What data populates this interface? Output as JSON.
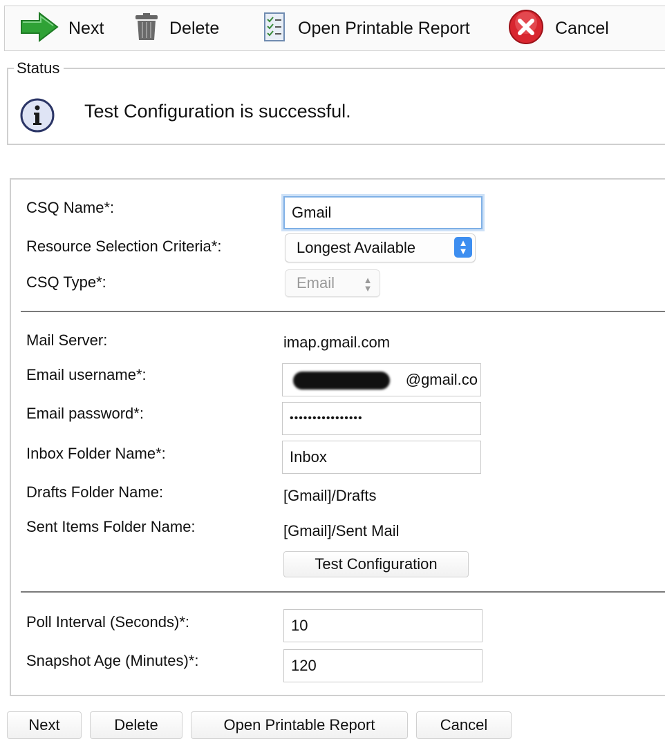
{
  "toolbar": {
    "next_label": "Next",
    "delete_label": "Delete",
    "report_label": "Open Printable Report",
    "cancel_label": "Cancel"
  },
  "status": {
    "legend": "Status",
    "message": "Test Configuration is successful."
  },
  "form": {
    "csq_name_label": "CSQ Name*:",
    "csq_name_value": "Gmail",
    "rsc_label": "Resource Selection Criteria*:",
    "rsc_value": "Longest Available",
    "csq_type_label": "CSQ Type*:",
    "csq_type_value": "Email",
    "mail_server_label": "Mail Server:",
    "mail_server_value": "imap.gmail.com",
    "email_user_label": "Email username*:",
    "email_user_value": "@gmail.co",
    "email_pass_label": "Email password*:",
    "email_pass_value": "••••••••••••••••",
    "inbox_label": "Inbox Folder Name*:",
    "inbox_value": "Inbox",
    "drafts_label": "Drafts Folder Name:",
    "drafts_value": "[Gmail]/Drafts",
    "sent_label": "Sent Items Folder Name:",
    "sent_value": "[Gmail]/Sent Mail",
    "test_button": "Test Configuration",
    "poll_label": "Poll Interval (Seconds)*:",
    "poll_value": "10",
    "snapshot_label": "Snapshot Age (Minutes)*:",
    "snapshot_value": "120"
  },
  "bottom": {
    "next_label": "Next",
    "delete_label": "Delete",
    "report_label": "Open Printable Report",
    "cancel_label": "Cancel"
  },
  "icons": {
    "next": "arrow-right-icon",
    "delete": "trash-icon",
    "report": "report-icon",
    "cancel": "cancel-icon",
    "status": "info-icon"
  },
  "colors": {
    "next_arrow": "#2fa236",
    "cancel_red": "#d8262f",
    "select_accent": "#3d8ef0",
    "focus_ring": "#7fb0e6"
  }
}
